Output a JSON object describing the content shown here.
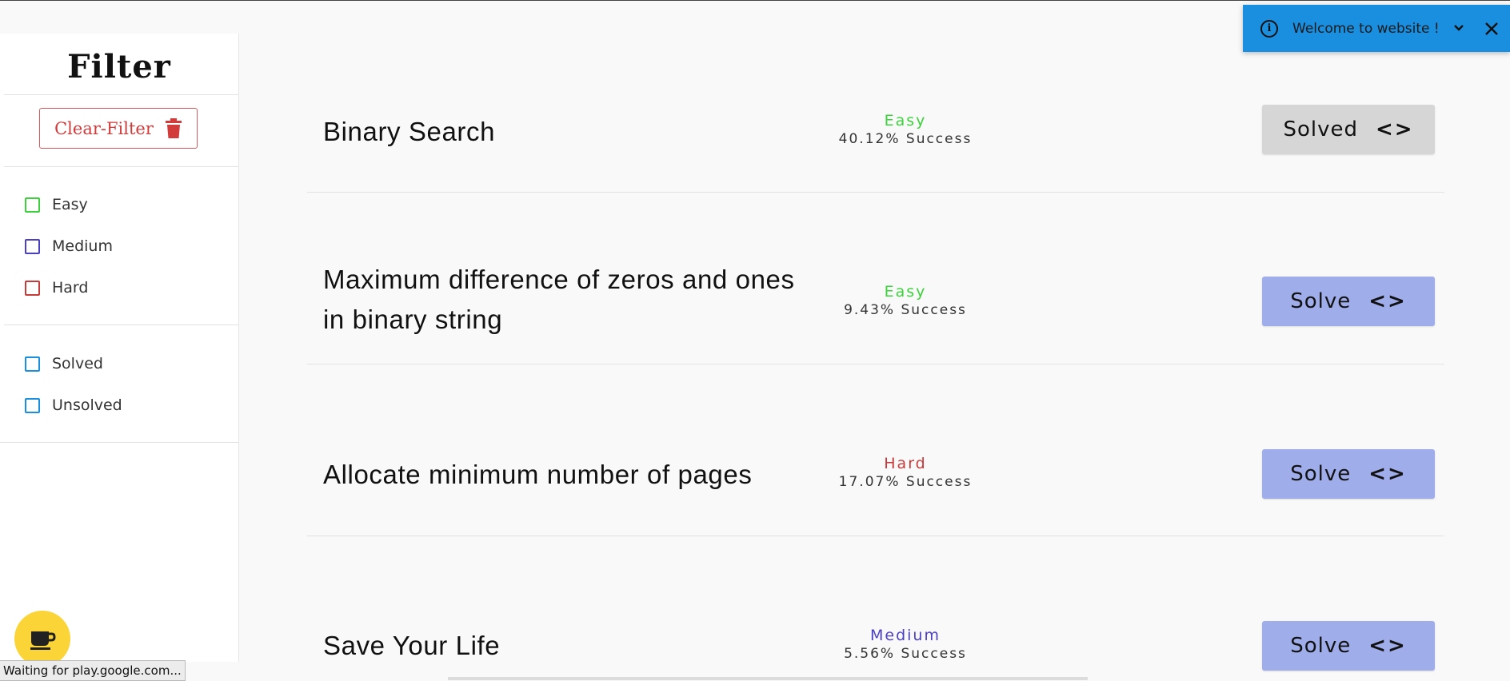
{
  "sidebar": {
    "title": "Filter",
    "clear_filter_label": "Clear-Filter",
    "difficulty_filters": [
      {
        "label": "Easy",
        "color": "#3dd13d"
      },
      {
        "label": "Medium",
        "color": "#4b3fc4"
      },
      {
        "label": "Hard",
        "color": "#c93a3a"
      }
    ],
    "status_filters": [
      {
        "label": "Solved",
        "color": "#1a8fe0"
      },
      {
        "label": "Unsolved",
        "color": "#1a8fe0"
      }
    ]
  },
  "problems": [
    {
      "title": "Binary Search",
      "difficulty": "Easy",
      "difficulty_color": "#3dd13d",
      "success": "40.12% Success",
      "button": "Solved",
      "solved": true
    },
    {
      "title": "Maximum difference of zeros and ones in binary string",
      "difficulty": "Easy",
      "difficulty_color": "#3dd13d",
      "success": "9.43% Success",
      "button": "Solve",
      "solved": false
    },
    {
      "title": "Allocate minimum number of pages",
      "difficulty": "Hard",
      "difficulty_color": "#c93a3a",
      "success": "17.07% Success",
      "button": "Solve",
      "solved": false
    },
    {
      "title": "Save Your Life",
      "difficulty": "Medium",
      "difficulty_color": "#4b3fc4",
      "success": "5.56% Success",
      "button": "Solve",
      "solved": false
    }
  ],
  "toast": {
    "message": "Welcome to website !",
    "background": "#1a8fe0"
  },
  "status_bar": {
    "text": "Waiting for play.google.com..."
  },
  "icons": {
    "info": "info-icon",
    "trash": "trash-icon",
    "code": "code-icon",
    "chevron": "chevron-down-icon",
    "close": "close-icon",
    "coffee": "coffee-icon"
  }
}
